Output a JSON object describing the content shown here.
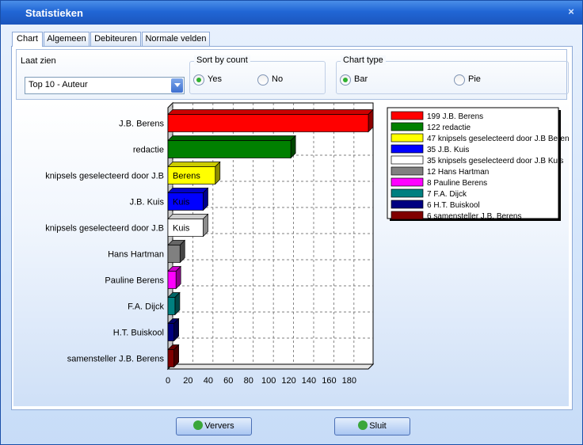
{
  "window": {
    "title": "Statistieken",
    "close_glyph": "×"
  },
  "tabs": [
    {
      "label": "Chart",
      "active": true
    },
    {
      "label": "Algemeen",
      "active": false
    },
    {
      "label": "Debiteuren",
      "active": false
    },
    {
      "label": "Normale velden",
      "active": false
    }
  ],
  "controls": {
    "show_label": "Laat zien",
    "show_value": "Top 10 - Auteur",
    "sort_label": "Sort by count",
    "sort_yes": "Yes",
    "sort_no": "No",
    "sort_selected": "Yes",
    "charttype_label": "Chart type",
    "charttype_bar": "Bar",
    "charttype_pie": "Pie",
    "charttype_selected": "Bar"
  },
  "buttons": {
    "refresh_label": "Ververs",
    "close_label": "Sluit"
  },
  "colors": {
    "accent": "#2166d5",
    "radio_on": "#2fb12f"
  },
  "chart_data": {
    "type": "bar",
    "orientation": "horizontal",
    "categories": [
      "J.B. Berens",
      "redactie",
      "knipsels geselecteerd door J.B",
      "J.B. Kuis",
      "knipsels geselecteerd door J.B",
      "Hans Hartman",
      "Pauline Berens",
      "F.A. Dijck",
      "H.T. Buiskool",
      "samensteller J.B. Berens"
    ],
    "values": [
      199,
      122,
      47,
      35,
      35,
      12,
      8,
      7,
      6,
      6
    ],
    "colors": [
      "#ff0000",
      "#008000",
      "#ffff00",
      "#0000ff",
      "#ffffff",
      "#808080",
      "#ff00ff",
      "#008080",
      "#000080",
      "#800000"
    ],
    "bar_overlay_labels": [
      "",
      "",
      "Berens",
      "Kuis",
      "Kuis",
      "",
      "",
      "",
      "",
      ""
    ],
    "xticks": [
      0,
      20,
      40,
      60,
      80,
      100,
      120,
      140,
      160,
      180
    ],
    "xlim": [
      0,
      199
    ],
    "grid": true,
    "legend_position": "top-right",
    "legend": [
      "199 J.B. Berens",
      "122 redactie",
      "47 knipsels geselecteerd door J.B Berens",
      "35 J.B. Kuis",
      "35 knipsels geselecteerd door J.B Kuis",
      "12 Hans Hartman",
      "8 Pauline Berens",
      "7 F.A. Dijck",
      "6 H.T. Buiskool",
      "6 samensteller J.B. Berens"
    ]
  }
}
